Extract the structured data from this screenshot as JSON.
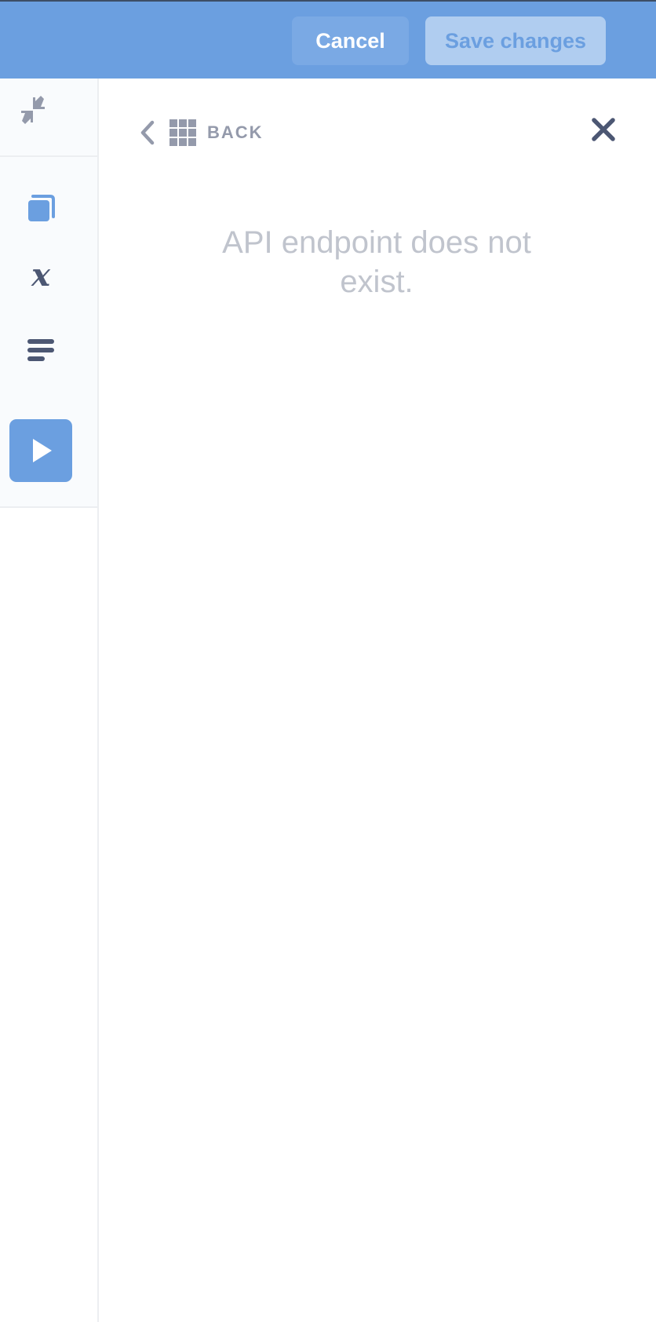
{
  "header": {
    "cancel_label": "Cancel",
    "save_label": "Save changes"
  },
  "sidebar": {
    "icons": [
      "collapse-icon",
      "snippet-icon",
      "variable-icon",
      "text-lines-icon"
    ],
    "run_icon": "play-icon"
  },
  "panel": {
    "back_label": "BACK",
    "message": "API endpoint does not exist."
  },
  "colors": {
    "accent": "#6b9fe0",
    "icon_dark": "#4c5773",
    "muted_text": "#c0c4cd",
    "back_text": "#949aab"
  }
}
